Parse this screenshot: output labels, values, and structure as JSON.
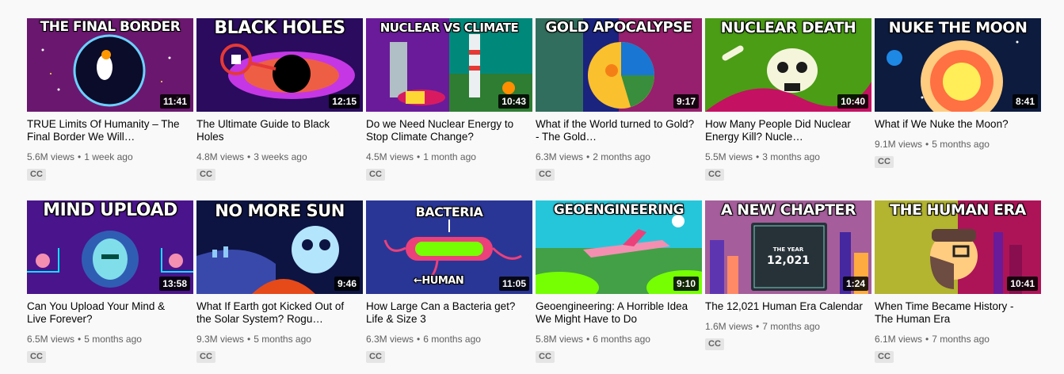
{
  "videos": [
    {
      "thumb_text": "THE FINAL BORDER",
      "duration": "11:41",
      "title": "TRUE Limits Of Humanity – The Final Border We Will…",
      "views": "5.6M views",
      "age": "1 week ago",
      "badge": "CC"
    },
    {
      "thumb_text": "BLACK HOLES",
      "duration": "12:15",
      "title": "The Ultimate Guide to Black Holes",
      "views": "4.8M views",
      "age": "3 weeks ago",
      "badge": "CC"
    },
    {
      "thumb_text": "NUCLEAR VS CLIMATE",
      "duration": "10:43",
      "title": "Do we Need Nuclear Energy to Stop Climate Change?",
      "views": "4.5M views",
      "age": "1 month ago",
      "badge": "CC"
    },
    {
      "thumb_text": "GOLD APOCALYPSE",
      "duration": "9:17",
      "title": "What if the World turned to Gold? - The Gold…",
      "views": "6.3M views",
      "age": "2 months ago",
      "badge": "CC"
    },
    {
      "thumb_text": "NUCLEAR DEATH",
      "duration": "10:40",
      "title": "How Many People Did Nuclear Energy Kill? Nucle…",
      "views": "5.5M views",
      "age": "3 months ago",
      "badge": "CC"
    },
    {
      "thumb_text": "NUKE THE MOON",
      "duration": "8:41",
      "title": "What if We Nuke the Moon?",
      "views": "9.1M views",
      "age": "5 months ago",
      "badge": "CC"
    },
    {
      "thumb_text": "MIND UPLOAD",
      "duration": "13:58",
      "title": "Can You Upload Your Mind & Live Forever?",
      "views": "6.5M views",
      "age": "5 months ago",
      "badge": "CC"
    },
    {
      "thumb_text": "NO MORE SUN",
      "duration": "9:46",
      "title": "What If Earth got Kicked Out of the Solar System? Rogu…",
      "views": "9.3M views",
      "age": "5 months ago",
      "badge": "CC"
    },
    {
      "thumb_text": "BACTERIA",
      "thumb_text2": "←HUMAN",
      "duration": "11:05",
      "title": "How Large Can a Bacteria get? Life & Size 3",
      "views": "6.3M views",
      "age": "6 months ago",
      "badge": "CC"
    },
    {
      "thumb_text": "GEOENGINEERING",
      "duration": "9:10",
      "title": "Geoengineering: A Horrible Idea We Might Have to Do",
      "views": "5.8M views",
      "age": "6 months ago",
      "badge": "CC"
    },
    {
      "thumb_text": "A NEW CHAPTER",
      "thumb_text2": "THE YEAR",
      "thumb_text3": "12,021",
      "duration": "1:24",
      "title": "The 12,021 Human Era Calendar",
      "views": "1.6M views",
      "age": "7 months ago",
      "badge": "CC"
    },
    {
      "thumb_text": "THE HUMAN ERA",
      "duration": "10:41",
      "title": "When Time Became History - The Human Era",
      "views": "6.1M views",
      "age": "7 months ago",
      "badge": "CC"
    }
  ],
  "colors": {
    "title_text": "#030303",
    "meta_text": "#606060",
    "badge_bg": "#e5e5e5",
    "page_bg": "#f9f9f9"
  }
}
